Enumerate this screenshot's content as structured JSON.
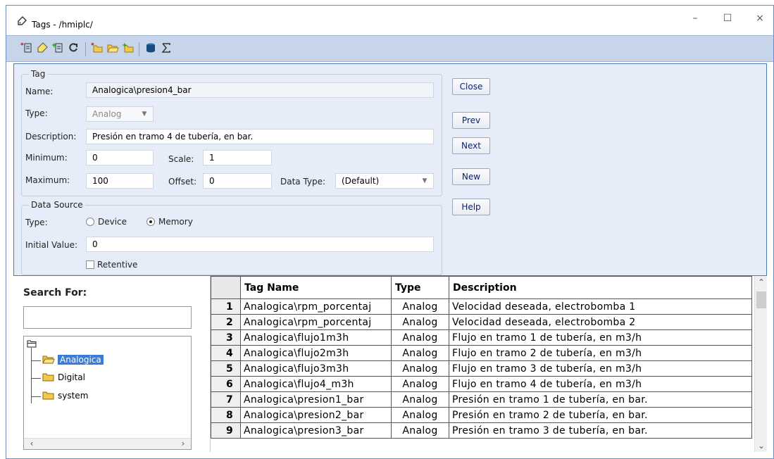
{
  "window": {
    "title": "Tags - /hmiplc/",
    "controls": {
      "minimize": "–",
      "maximize": "☐",
      "close": "×"
    }
  },
  "toolbar": {
    "icons": [
      "new-tag-icon",
      "tag-icon",
      "insert-tag-icon",
      "refresh-icon",
      "new-folder-icon",
      "open-folder-icon",
      "add-folder-icon",
      "database-icon",
      "sum-icon"
    ]
  },
  "tag": {
    "legend": "Tag",
    "name_label": "Name:",
    "name_value": "Analogica\\presion4_bar",
    "type_label": "Type:",
    "type_value": "Analog",
    "description_label": "Description:",
    "description_value": "Presión en tramo 4 de tubería, en bar.",
    "minimum_label": "Minimum:",
    "minimum_value": "0",
    "scale_label": "Scale:",
    "scale_value": "1",
    "maximum_label": "Maximum:",
    "maximum_value": "100",
    "offset_label": "Offset:",
    "offset_value": "0",
    "datatype_label": "Data Type:",
    "datatype_value": "(Default)"
  },
  "data_source": {
    "legend": "Data Source",
    "type_label": "Type:",
    "option_device": "Device",
    "option_memory": "Memory",
    "selected": "Memory",
    "initial_value_label": "Initial Value:",
    "initial_value": "0",
    "retentive_label": "Retentive",
    "retentive_checked": false
  },
  "buttons": {
    "close": "Close",
    "prev": "Prev",
    "next": "Next",
    "new": "New",
    "help": "Help"
  },
  "search": {
    "label": "Search For:",
    "value": ""
  },
  "tree": {
    "items": [
      {
        "label": "Analogica",
        "selected": true
      },
      {
        "label": "Digital",
        "selected": false
      },
      {
        "label": "system",
        "selected": false
      }
    ]
  },
  "table": {
    "headers": {
      "name": "Tag Name",
      "type": "Type",
      "description": "Description"
    },
    "rows": [
      {
        "num": "1",
        "name": "Analogica\\rpm_porcentaj",
        "type": "Analog",
        "description": "Velocidad deseada, electrobomba 1"
      },
      {
        "num": "2",
        "name": "Analogica\\rpm_porcentaj",
        "type": "Analog",
        "description": "Velocidad deseada, electrobomba 2"
      },
      {
        "num": "3",
        "name": "Analogica\\flujo1m3h",
        "type": "Analog",
        "description": "Flujo en tramo 1 de tubería, en m3/h"
      },
      {
        "num": "4",
        "name": "Analogica\\flujo2m3h",
        "type": "Analog",
        "description": "Flujo en tramo 2 de tubería, en m3/h"
      },
      {
        "num": "5",
        "name": "Analogica\\flujo3m3h",
        "type": "Analog",
        "description": "Flujo en tramo 3 de tubería, en m3/h"
      },
      {
        "num": "6",
        "name": "Analogica\\flujo4_m3h",
        "type": "Analog",
        "description": "Flujo en tramo 4 de tubería, en m3/h"
      },
      {
        "num": "7",
        "name": "Analogica\\presion1_bar",
        "type": "Analog",
        "description": "Presión en tramo 1 de tubería, en bar."
      },
      {
        "num": "8",
        "name": "Analogica\\presion2_bar",
        "type": "Analog",
        "description": "Presión en tramo 2 de tubería, en bar."
      },
      {
        "num": "9",
        "name": "Analogica\\presion3_bar",
        "type": "Analog",
        "description": "Presión en tramo 3 de tubería, en bar."
      }
    ]
  }
}
